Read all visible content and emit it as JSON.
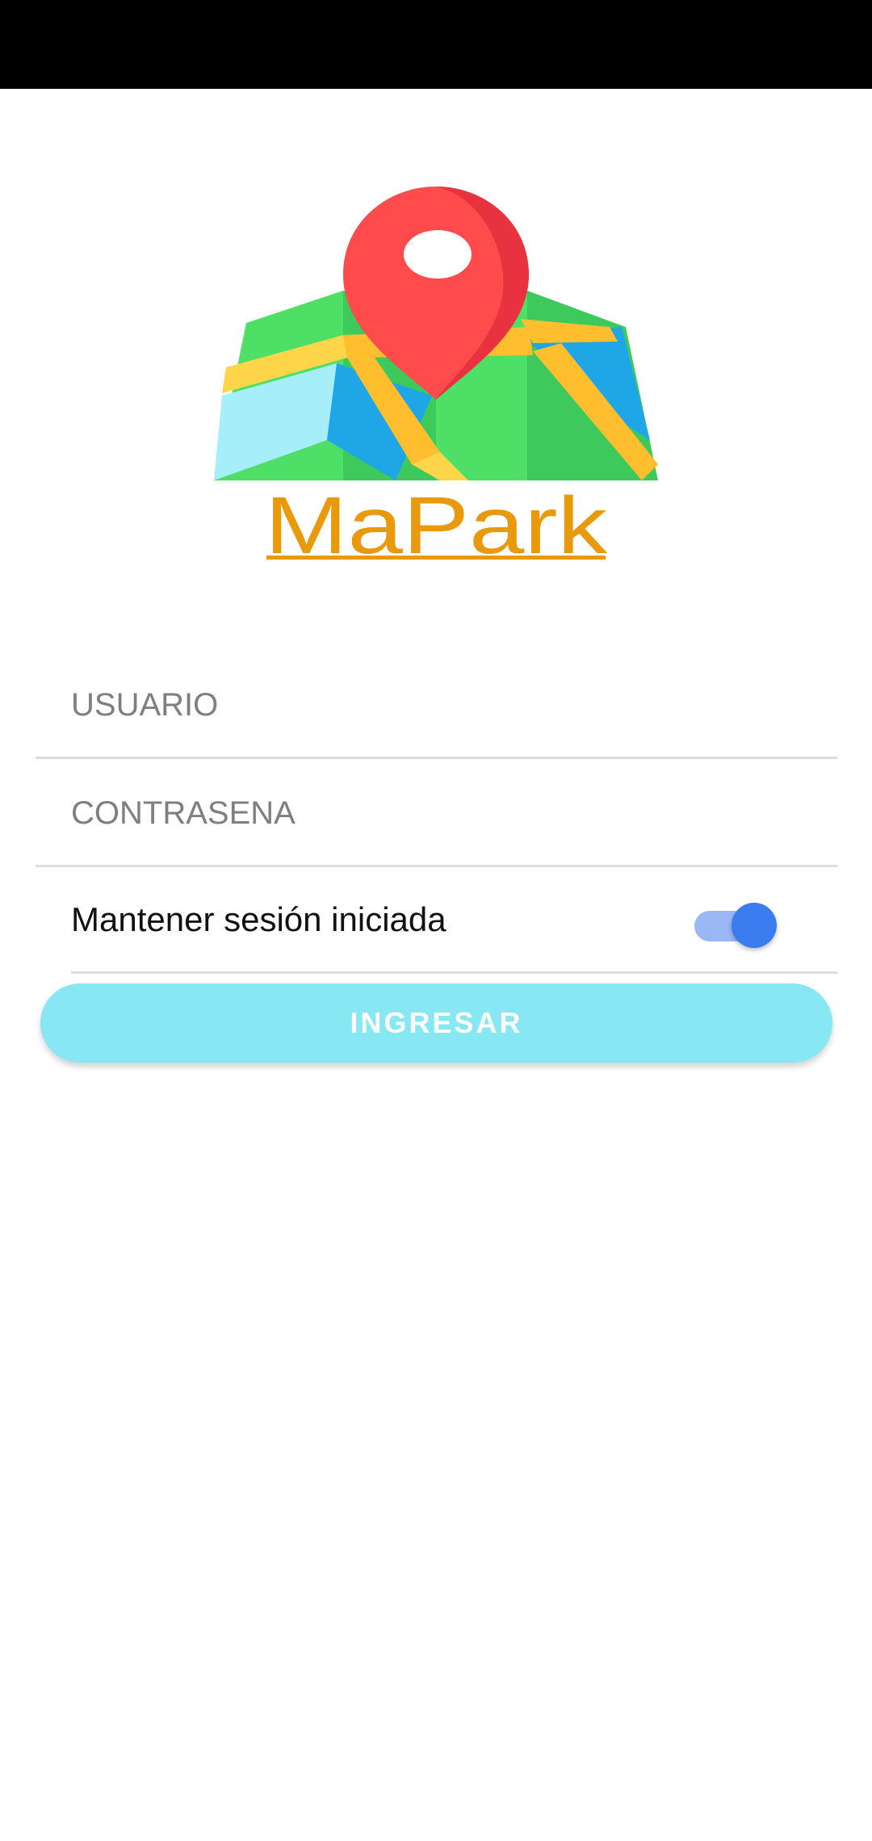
{
  "app": {
    "logo_text": "MaPark"
  },
  "login": {
    "username_placeholder": "USUARIO",
    "username_value": "",
    "password_placeholder": "CONTRASENA",
    "password_value": "",
    "keep_session_label": "Mantener sesión iniciada",
    "keep_session_enabled": true,
    "submit_label": "INGRESAR"
  },
  "icons": {
    "logo": "map-pin-logo-icon",
    "toggle": "toggle-switch-icon"
  },
  "colors": {
    "status_bar": "#000000",
    "background": "#ffffff",
    "logo_text": "#e89a0c",
    "pin_red": "#ff4b4b",
    "toggle_on": "#3b7cf0",
    "button": "#87e8f4",
    "divider": "#dddddd"
  }
}
